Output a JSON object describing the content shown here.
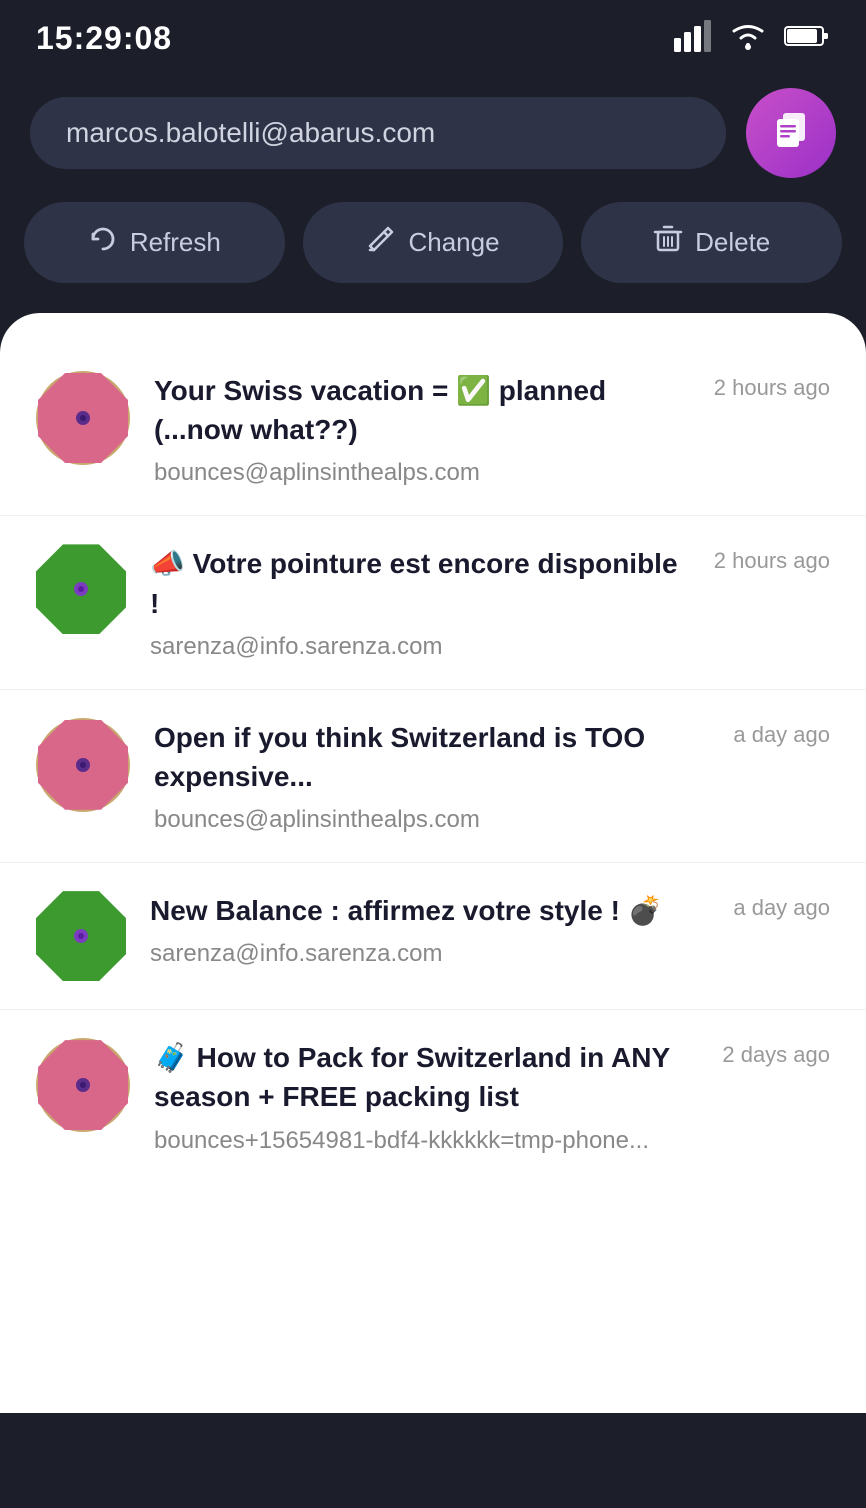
{
  "statusBar": {
    "time": "15:29:08"
  },
  "account": {
    "email": "marcos.balotelli@abarus.com",
    "avatarIcon": "📋"
  },
  "actions": {
    "refresh": "Refresh",
    "change": "Change",
    "delete": "Delete"
  },
  "emails": [
    {
      "id": 1,
      "subject": "Your Swiss vacation = ✅ planned (...now what??)",
      "from": "bounces@aplinsinthealps.com",
      "time": "2 hours ago",
      "avatarType": "pink-gold",
      "avatarColor": "#d9678a"
    },
    {
      "id": 2,
      "subject": "📣 Votre pointure est encore disponible !",
      "from": "sarenza@info.sarenza.com",
      "time": "2 hours ago",
      "avatarType": "green",
      "avatarColor": "#3c9a2e"
    },
    {
      "id": 3,
      "subject": "Open if you think Switzerland is TOO expensive...",
      "from": "bounces@aplinsinthealps.com",
      "time": "a day ago",
      "avatarType": "pink-gold",
      "avatarColor": "#d9678a"
    },
    {
      "id": 4,
      "subject": "New Balance : affirmez votre style ! 💣",
      "from": "sarenza@info.sarenza.com",
      "time": "a day ago",
      "avatarType": "green",
      "avatarColor": "#3c9a2e"
    },
    {
      "id": 5,
      "subject": "🧳 How to Pack for Switzerland in ANY season + FREE packing list",
      "from": "bounces+15654981-bdf4-kkkkkk=tmp-phone...",
      "time": "2 days ago",
      "avatarType": "pink-gold",
      "avatarColor": "#d9678a"
    }
  ]
}
